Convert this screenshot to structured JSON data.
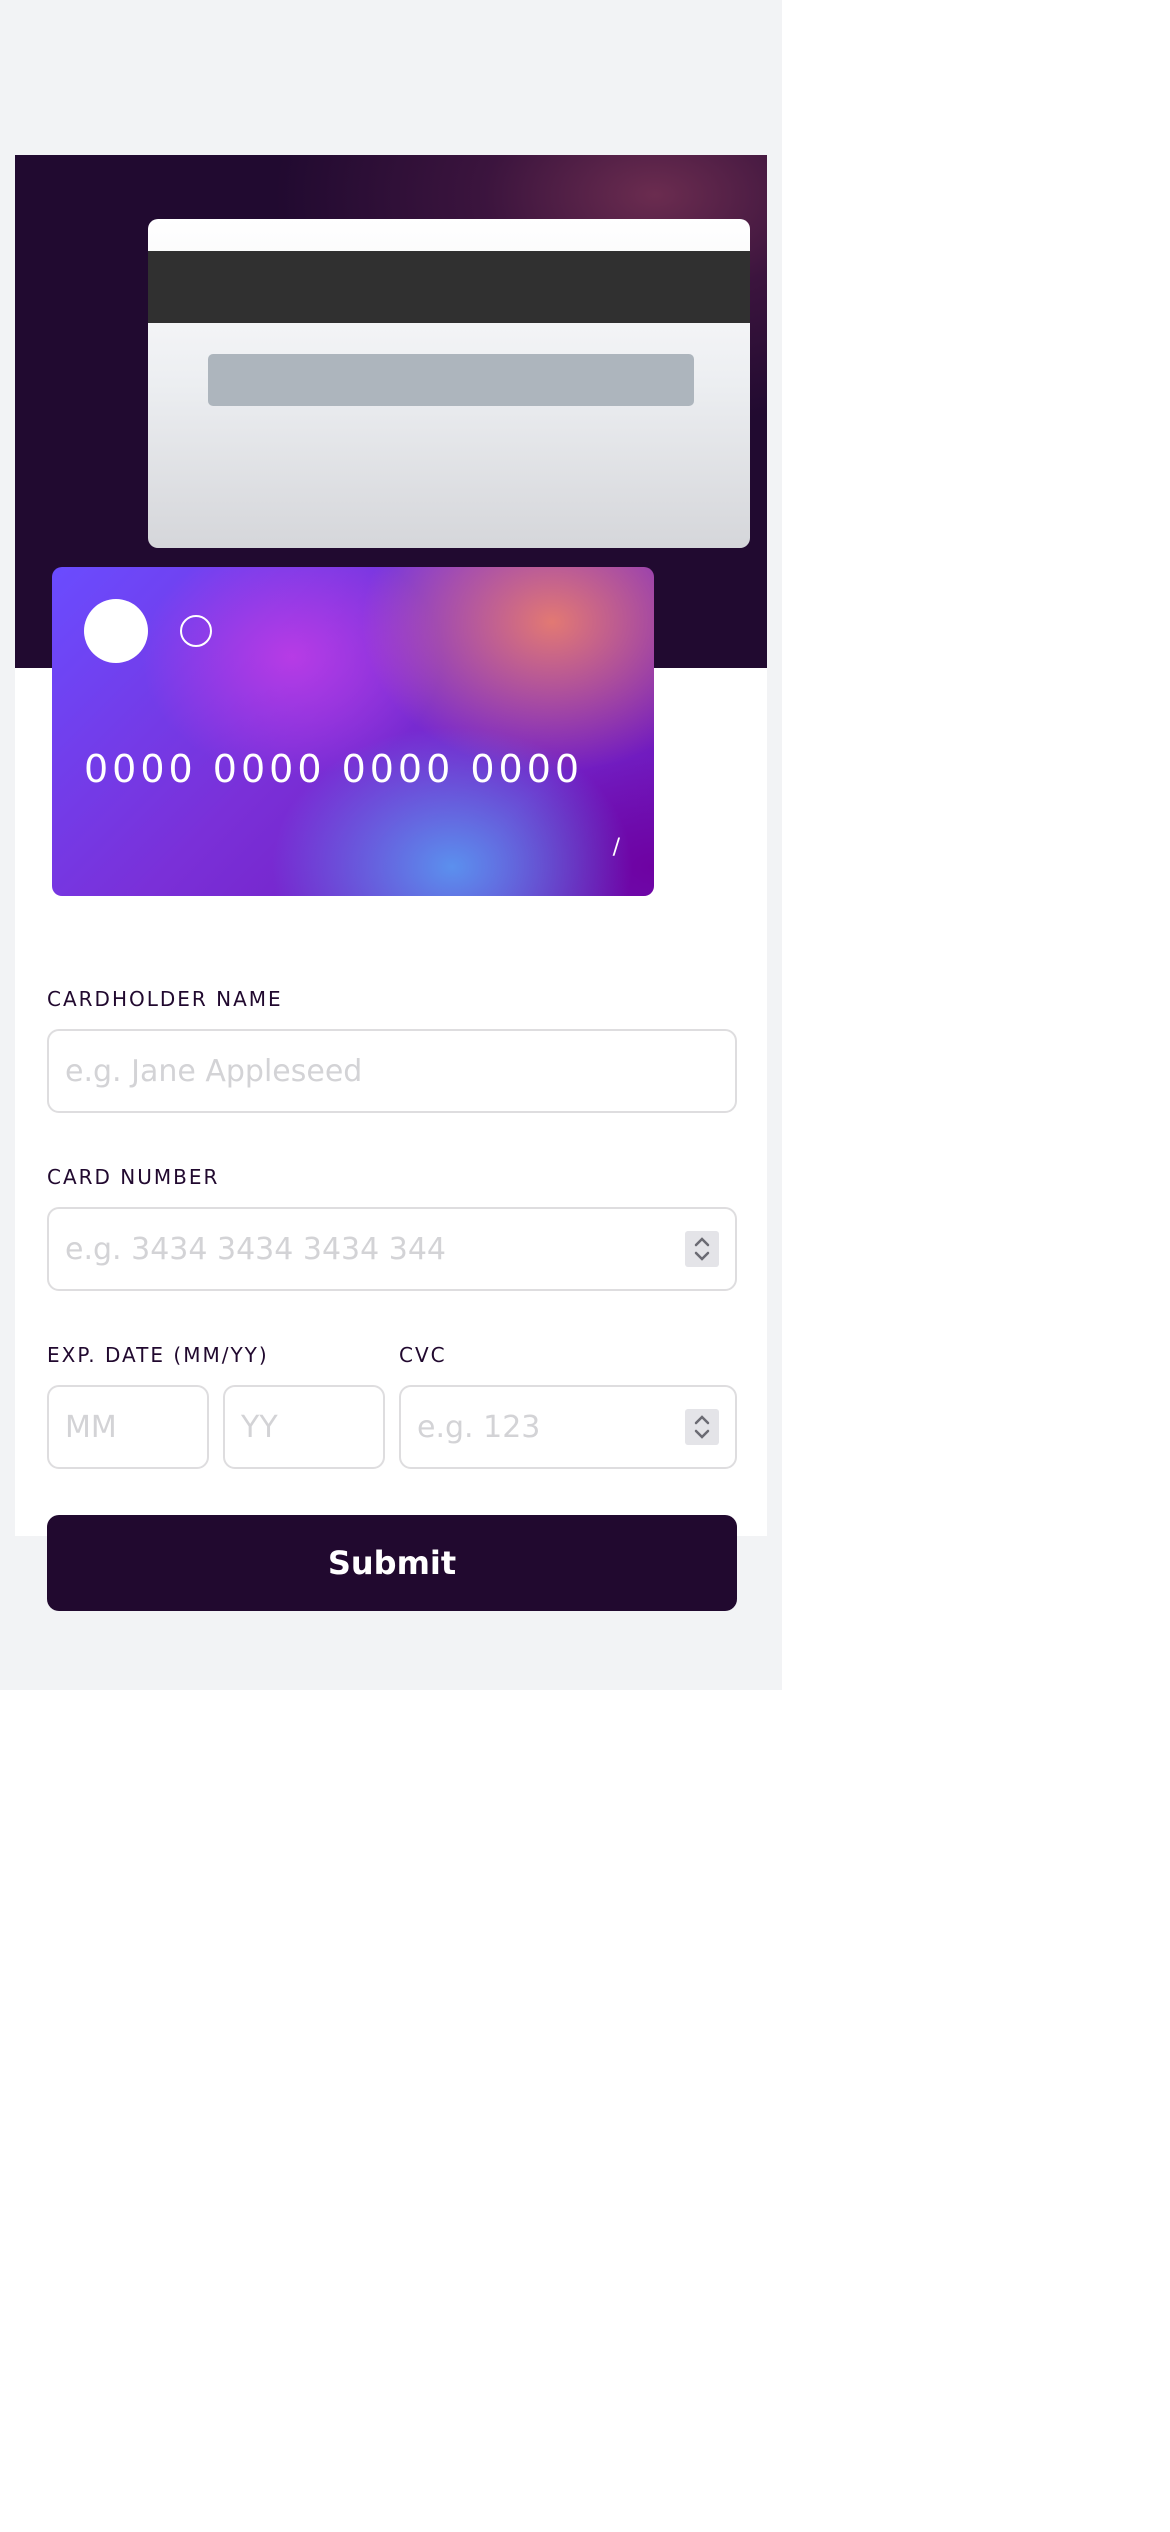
{
  "card_preview": {
    "number": "0000 0000 0000 0000",
    "name": "",
    "exp_month": "",
    "exp_separator": "/",
    "exp_year": "",
    "cvc": ""
  },
  "form": {
    "cardholder_name": {
      "label": "Cardholder Name",
      "placeholder": "e.g. Jane Appleseed",
      "value": ""
    },
    "card_number": {
      "label": "Card Number",
      "placeholder": "e.g. 3434 3434 3434 344",
      "value": ""
    },
    "exp_date": {
      "label": "Exp. Date (MM/YY)",
      "month_placeholder": "MM",
      "year_placeholder": "YY"
    },
    "cvc": {
      "label": "CVC",
      "placeholder": "e.g. 123",
      "value": ""
    },
    "submit_label": "Submit"
  },
  "colors": {
    "page_bg": "#f2f3f5",
    "hero_bg": "#210a30",
    "accent_dark": "#21092f",
    "input_border": "#dedddf",
    "placeholder": "#d3d3d6"
  },
  "icons": {
    "card_logo_large": "filled-circle",
    "card_logo_small": "outlined-circle",
    "stepper": "chevron-up-down"
  }
}
